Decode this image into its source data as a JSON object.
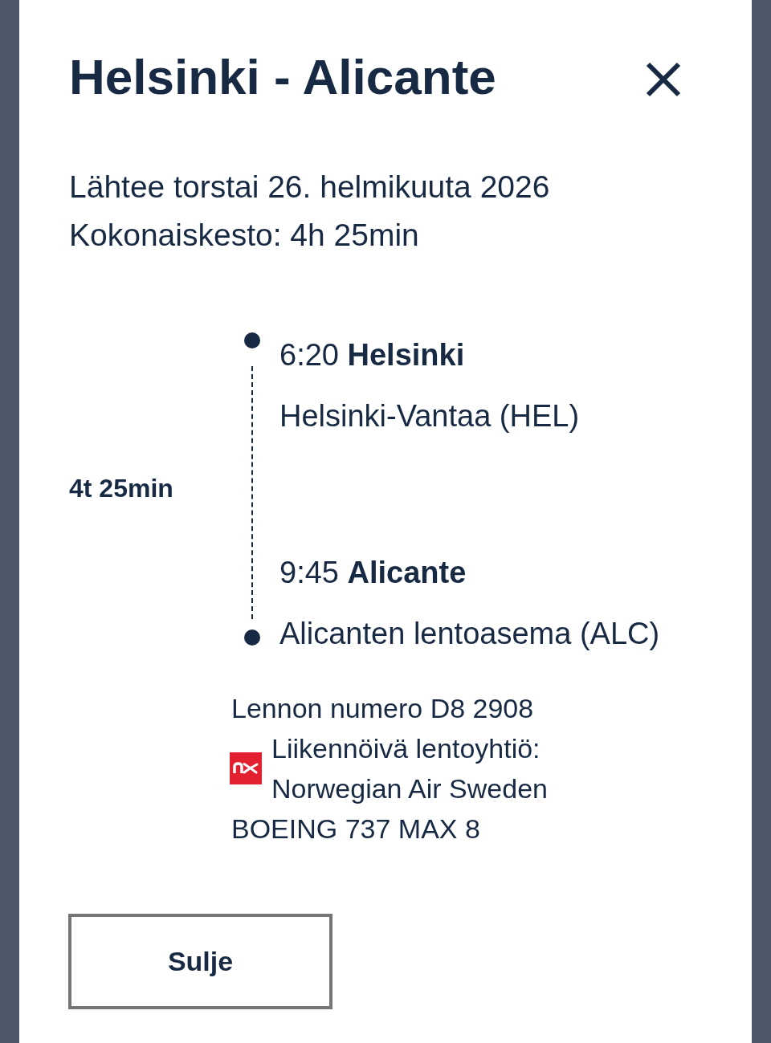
{
  "dialog": {
    "title": "Helsinki - Alicante",
    "departure_date": "Lähtee torstai 26. helmikuuta 2026",
    "total_duration": "Kokonaiskesto: 4h 25min"
  },
  "itinerary": {
    "duration": "4t 25min",
    "stops": [
      {
        "heading": "6:20 **Helsinki**",
        "airport": "Helsinki-Vantaa (HEL)"
      },
      {
        "heading": "9:45 **Alicante**",
        "airport": "Alicanten lentoasema (ALC)"
      }
    ]
  },
  "flight": {
    "number": "Lennon numero D8 2908",
    "operator_label": "Liikennöivä lentoyhtiö:",
    "operator": "Norwegian Air Sweden",
    "aircraft": "BOEING 737 MAX 8"
  },
  "close_button": {
    "label": "Sulje"
  }
}
